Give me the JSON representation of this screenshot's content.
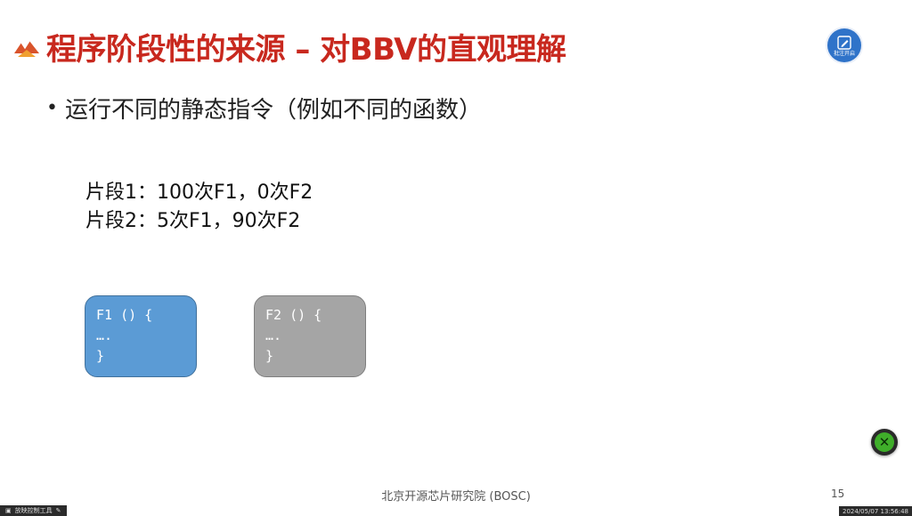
{
  "slide": {
    "title": "程序阶段性的来源 – 对BBV的直观理解",
    "bullet": "运行不同的静态指令（例如不同的函数）",
    "segment_lines": [
      "片段1：100次F1，0次F2",
      "片段2：5次F1，90次F2"
    ],
    "code_boxes": [
      {
        "lines": [
          "F1 () {",
          "….",
          "}"
        ],
        "color": "#5b9bd5"
      },
      {
        "lines": [
          "F2 () {",
          "….",
          "}"
        ],
        "color": "#a5a5a5"
      }
    ],
    "footer": "北京开源芯片研究院 (BOSC)",
    "page_number": "15"
  },
  "overlay": {
    "badge_label": "批注开启",
    "badge_color": "#2f73c9",
    "close_button_color": "#3fae2a",
    "bottom_left_text": "放映控制工具",
    "timestamp": "2024/05/07 13:56:48"
  },
  "icons": {
    "logo": "mountain-logo-icon",
    "badge": "pen-annotation-icon",
    "close": "close-icon"
  },
  "colors": {
    "title": "#c8281e",
    "accent_blue": "#5b9bd5",
    "accent_gray": "#a5a5a5"
  }
}
